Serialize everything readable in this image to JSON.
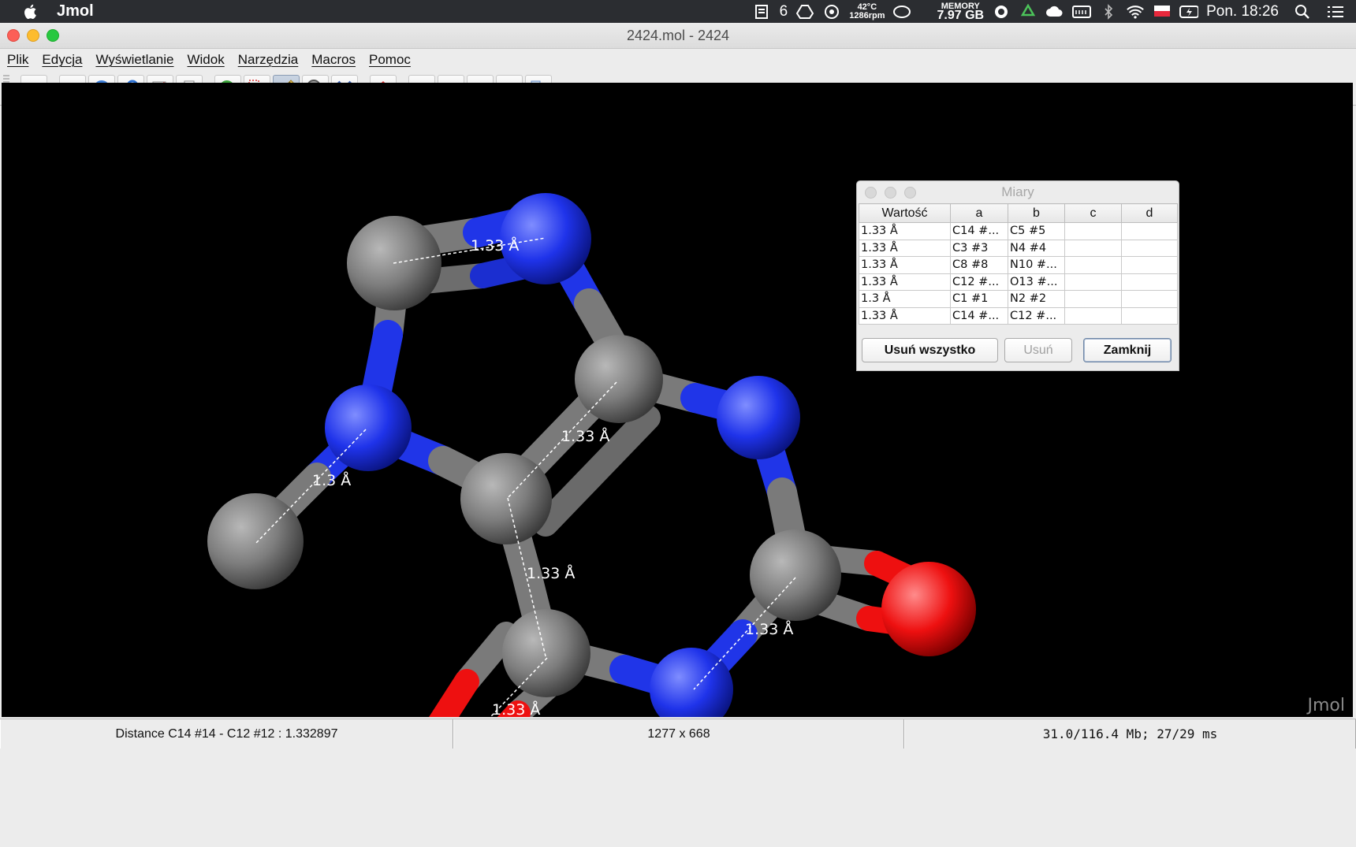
{
  "menubar": {
    "app_name": "Jmol",
    "badge_count": "6",
    "temperature": "42°C",
    "fan": "1286rpm",
    "memory_label": "MEMORY",
    "memory_value": "7.97 GB",
    "clock": "Pon. 18:26"
  },
  "window": {
    "title": "2424.mol - 2424"
  },
  "jmenu": {
    "items": [
      "Plik",
      "Edycja",
      "Wyświetlanie",
      "Widok",
      "Narzędzia",
      "Macros",
      "Pomoc"
    ]
  },
  "toolbar": {
    "icons": [
      "open-icon",
      "camera-icon",
      "web-icon",
      "search-icon",
      "edit-icon",
      "print-icon",
      "rotate-icon",
      "select-icon",
      "ruler-icon",
      "pick-center-icon",
      "delete-icon",
      "home-icon",
      "first-frame-icon",
      "prev-frame-icon",
      "next-frame-icon",
      "last-frame-icon",
      "copy-icon"
    ],
    "pressed": "ruler-icon"
  },
  "canvas": {
    "watermark": "Jmol",
    "measurement_labels": [
      "1.33 Å",
      "1.33 Å",
      "1.3 Å",
      "1.33 Å",
      "1.33 Å",
      "1.33 Å"
    ],
    "colors": {
      "carbon": "#7a7a7a",
      "nitrogen": "#2035e8",
      "oxygen": "#ee1010",
      "background": "#000000"
    }
  },
  "dialog": {
    "title": "Miary",
    "columns": [
      "Wartość",
      "a",
      "b",
      "c",
      "d"
    ],
    "rows": [
      [
        "1.33 Å",
        "C14 #...",
        "C5 #5",
        "",
        ""
      ],
      [
        "1.33 Å",
        "C3 #3",
        "N4 #4",
        "",
        ""
      ],
      [
        "1.33 Å",
        "C8 #8",
        "N10 #...",
        "",
        ""
      ],
      [
        "1.33 Å",
        "C12 #...",
        "O13 #...",
        "",
        ""
      ],
      [
        "1.3 Å",
        "C1 #1",
        "N2 #2",
        "",
        ""
      ],
      [
        "1.33 Å",
        "C14 #...",
        "C12 #...",
        "",
        ""
      ]
    ],
    "buttons": {
      "delete_all": "Usuń wszystko",
      "delete": "Usuń",
      "close": "Zamknij"
    }
  },
  "status": {
    "measurement": "Distance C14 #14 - C12 #12 : 1.332897",
    "size": "1277 x 668",
    "memory": "31.0/116.4 Mb;  27/29 ms"
  }
}
